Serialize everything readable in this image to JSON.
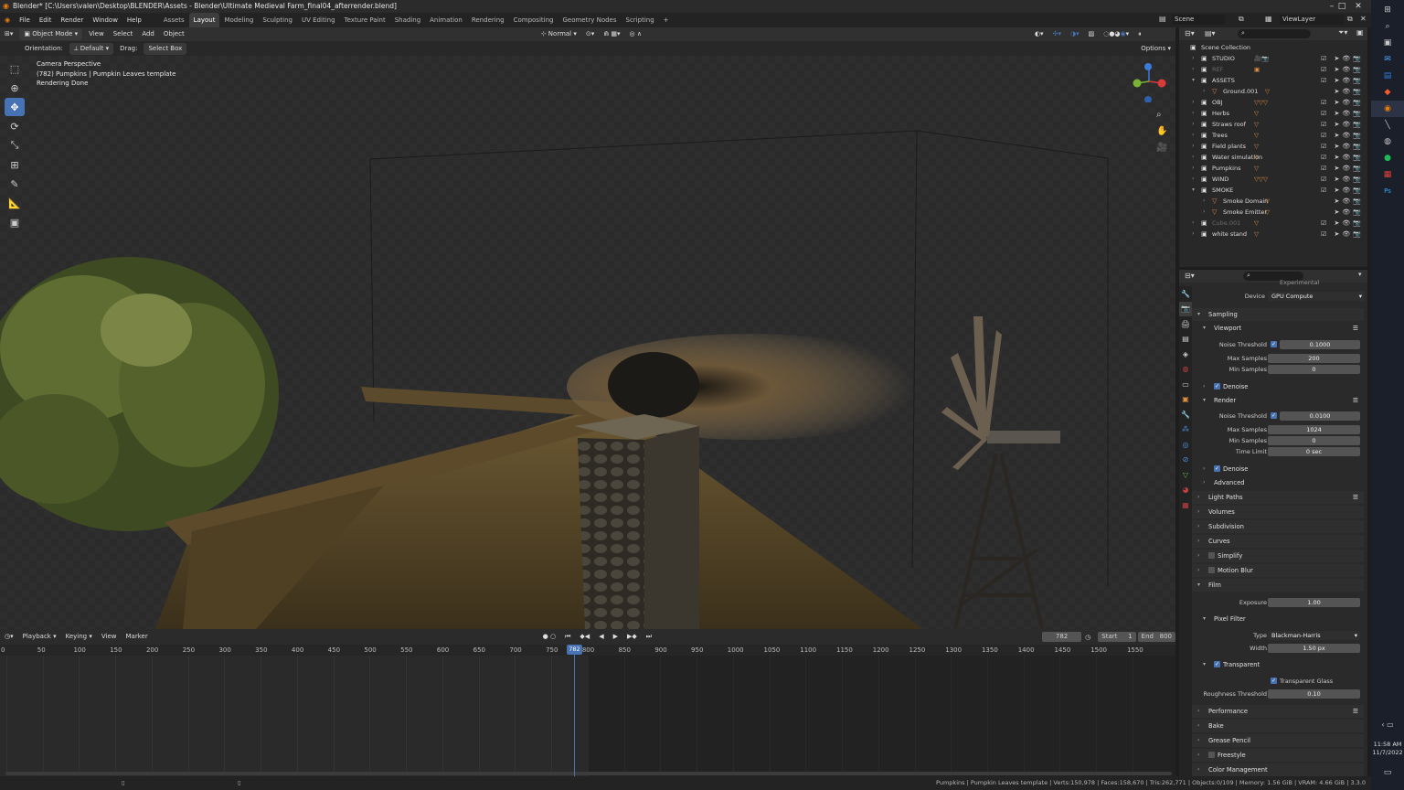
{
  "titlebar": {
    "title": "Blender* [C:\\Users\\valen\\Desktop\\BLENDER\\Assets - Blender\\Ultimate Medieval Farm_final04_afterrender.blend]",
    "minimize": "–",
    "maximize": "□",
    "close": "✕"
  },
  "menu": {
    "file": "File",
    "edit": "Edit",
    "render": "Render",
    "window": "Window",
    "help": "Help"
  },
  "workspaces": [
    "Assets",
    "Layout",
    "Modeling",
    "Sculpting",
    "UV Editing",
    "Texture Paint",
    "Shading",
    "Animation",
    "Rendering",
    "Compositing",
    "Geometry Nodes",
    "Scripting",
    "+"
  ],
  "active_workspace": "Layout",
  "scene": {
    "label": "Scene",
    "viewlayer": "ViewLayer"
  },
  "viewport_header": {
    "mode": "Object Mode",
    "view": "View",
    "select": "Select",
    "add": "Add",
    "object": "Object",
    "transform": "Normal",
    "options": "Options"
  },
  "tool_settings": {
    "orientation_label": "Orientation:",
    "orientation": "Default",
    "drag_label": "Drag:",
    "drag": "Select Box"
  },
  "overlay": {
    "line1": "Camera Perspective",
    "line2": "(782) Pumpkins | Pumpkin Leaves template",
    "line3": "Rendering Done"
  },
  "gizmo": {
    "x": "X",
    "y": "Y",
    "z": "Z"
  },
  "outliner": {
    "root": "Scene Collection",
    "items": [
      {
        "name": "STUDIO",
        "dim": false,
        "expanded": false,
        "depth": 0,
        "icons": "🎥📷"
      },
      {
        "name": "REF",
        "dim": true,
        "expanded": false,
        "depth": 0,
        "icons": "▣"
      },
      {
        "name": "ASSETS",
        "dim": false,
        "expanded": true,
        "depth": 0,
        "icons": ""
      },
      {
        "name": "Ground.001",
        "dim": false,
        "expanded": false,
        "depth": 1,
        "icons": "▽"
      },
      {
        "name": "OBJ",
        "dim": false,
        "expanded": false,
        "depth": 0,
        "icons": "▽▽▽"
      },
      {
        "name": "Herbs",
        "dim": false,
        "expanded": false,
        "depth": 0,
        "icons": "▽"
      },
      {
        "name": "Straws roof",
        "dim": false,
        "expanded": false,
        "depth": 0,
        "icons": "▽"
      },
      {
        "name": "Trees",
        "dim": false,
        "expanded": false,
        "depth": 0,
        "icons": "▽"
      },
      {
        "name": "Field plants",
        "dim": false,
        "expanded": false,
        "depth": 0,
        "icons": "▽"
      },
      {
        "name": "Water simulation",
        "dim": false,
        "expanded": false,
        "depth": 0,
        "icons": "▽"
      },
      {
        "name": "Pumpkins",
        "dim": false,
        "expanded": false,
        "depth": 0,
        "icons": "▽"
      },
      {
        "name": "WIND",
        "dim": false,
        "expanded": false,
        "depth": 0,
        "icons": "▽▽▽"
      },
      {
        "name": "SMOKE",
        "dim": false,
        "expanded": true,
        "depth": 0,
        "icons": ""
      },
      {
        "name": "Smoke Domain",
        "dim": false,
        "expanded": false,
        "depth": 1,
        "icons": "▽"
      },
      {
        "name": "Smoke Emitter",
        "dim": false,
        "expanded": false,
        "depth": 1,
        "icons": "▽"
      },
      {
        "name": "Cube.001",
        "dim": true,
        "expanded": false,
        "depth": 0,
        "icons": "▽"
      },
      {
        "name": "white stand",
        "dim": false,
        "expanded": false,
        "depth": 0,
        "icons": "▽"
      }
    ]
  },
  "properties": {
    "feature_set": "Experimental",
    "device_label": "Device",
    "device": "GPU Compute",
    "sampling": "Sampling",
    "viewport": "Viewport",
    "noise_threshold_label": "Noise Threshold",
    "vp_noise": "0.1000",
    "max_samples_label": "Max Samples",
    "vp_max": "200",
    "min_samples_label": "Min Samples",
    "vp_min": "0",
    "denoise": "Denoise",
    "render": "Render",
    "r_noise": "0.0100",
    "r_max": "1024",
    "r_min": "0",
    "time_limit_label": "Time Limit",
    "r_time": "0 sec",
    "advanced": "Advanced",
    "light_paths": "Light Paths",
    "volumes": "Volumes",
    "subdivision": "Subdivision",
    "curves": "Curves",
    "simplify": "Simplify",
    "motion_blur": "Motion Blur",
    "film": "Film",
    "exposure_label": "Exposure",
    "exposure": "1.00",
    "pixel_filter": "Pixel Filter",
    "type_label": "Type",
    "type": "Blackman-Harris",
    "width_label": "Width",
    "width": "1.50 px",
    "transparent": "Transparent",
    "transparent_glass": "Transparent Glass",
    "roughness_label": "Roughness Threshold",
    "roughness": "0.10",
    "performance": "Performance",
    "bake": "Bake",
    "grease_pencil": "Grease Pencil",
    "freestyle": "Freestyle",
    "color_management": "Color Management"
  },
  "timeline": {
    "playback": "Playback",
    "keying": "Keying",
    "view": "View",
    "marker": "Marker",
    "current_frame": "782",
    "start_label": "Start",
    "start": "1",
    "end_label": "End",
    "end": "800",
    "ticks": [
      "0",
      "50",
      "100",
      "150",
      "200",
      "250",
      "300",
      "350",
      "400",
      "450",
      "500",
      "550",
      "600",
      "650",
      "700",
      "750",
      "800",
      "850",
      "900",
      "950",
      "1000",
      "1050",
      "1100",
      "1150",
      "1200",
      "1250",
      "1300",
      "1350",
      "1400",
      "1450",
      "1500",
      "1550"
    ]
  },
  "statusbar": {
    "text": "Pumpkins | Pumpkin Leaves template | Verts:150,978 | Faces:158,670 | Tris:262,771 | Objects:0/109 | Memory: 1.56 GiB | VRAM: 4.66 GiB | 3.3.0"
  },
  "taskbar": {
    "time": "11:58 AM",
    "date": "11/7/2022"
  },
  "colors": {
    "accent": "#4772b3",
    "playhead": "#4772b3",
    "background": "#1d1d1d"
  }
}
